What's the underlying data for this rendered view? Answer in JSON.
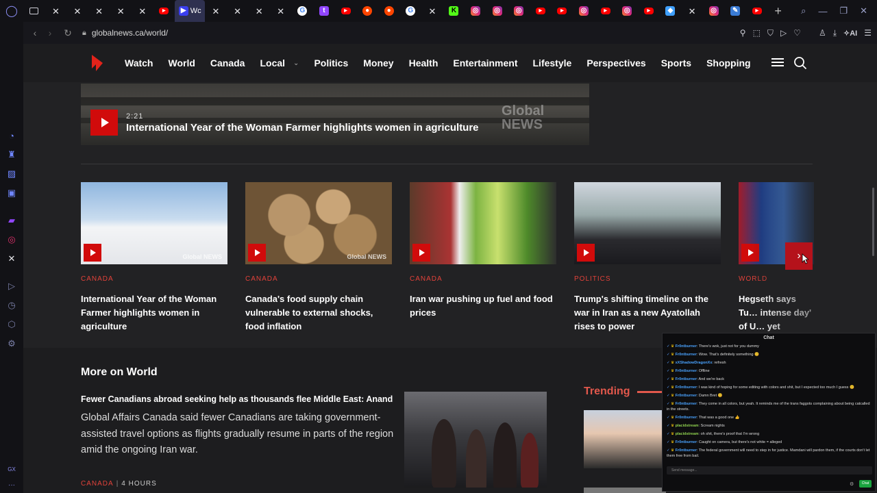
{
  "browser": {
    "url": "globalnews.ca/world/",
    "active_tab_label": "Wc",
    "tabs": [
      "mail",
      "x",
      "x",
      "x",
      "x",
      "x",
      "yt",
      "wc",
      "x",
      "x",
      "x",
      "x",
      "g",
      "tw",
      "yt",
      "rd",
      "rd",
      "g",
      "x",
      "kk",
      "ig",
      "ig",
      "ig",
      "yt",
      "yt",
      "ig",
      "yt",
      "ig",
      "yt",
      "bl",
      "x",
      "ig",
      "pen",
      "yt"
    ],
    "ai_label": "AI",
    "sidebar_label": "GX"
  },
  "site_nav": {
    "items": [
      "Watch",
      "World",
      "Canada",
      "Local",
      "Politics",
      "Money",
      "Health",
      "Entertainment",
      "Lifestyle",
      "Perspectives",
      "Sports",
      "Shopping"
    ]
  },
  "hero": {
    "duration": "2:21",
    "title": "International Year of the Woman Farmer highlights women in agriculture",
    "watermark_line1": "Global",
    "watermark_line2": "NEWS"
  },
  "cards": [
    {
      "category": "CANADA",
      "title": "International Year of the Woman Farmer highlights women in agriculture",
      "watermark": "Global NEWS"
    },
    {
      "category": "CANADA",
      "title": "Canada's food supply chain vulnerable to external shocks, food inflation",
      "watermark": "Global NEWS"
    },
    {
      "category": "CANADA",
      "title": "Iran war pushing up fuel and food prices",
      "watermark": ""
    },
    {
      "category": "POLITICS",
      "title": "Trump's shifting timeline on the war in Iran as a new Ayatollah rises to power",
      "watermark": ""
    },
    {
      "category": "WORLD",
      "title": "Hegseth says Tu… intense day' of U… yet",
      "watermark": ""
    }
  ],
  "more_on_world": {
    "heading": "More on World",
    "article_title": "Fewer Canadians abroad seeking help as thousands flee Middle East: Anand",
    "article_summary": "Global Affairs Canada said fewer Canadians are taking government-assisted travel options as flights gradually resume in parts of the region amid the ongoing Iran war.",
    "article_category": "CANADA",
    "article_time": "4 HOURS",
    "meta_separator": "|"
  },
  "trending": {
    "heading": "Trending"
  },
  "chat": {
    "title": "Chat",
    "messages": [
      {
        "user": "Fr0ntburner",
        "text": "There's wok, just not for you dummy"
      },
      {
        "user": "Fr0ntburner",
        "text": "Wow. That's definitely something 😊"
      },
      {
        "user": "xXShadowDragonXx",
        "text": "refresh"
      },
      {
        "user": "Fr0ntburner",
        "text": "Offline"
      },
      {
        "user": "Fr0ntburner",
        "text": "And we're back"
      },
      {
        "user": "Fr0ntburner",
        "text": "I was kind of hoping for some editing with colors and shit, but I expected too much I guess 😊"
      },
      {
        "user": "Fr0ntburner",
        "text": "Damn Bret 😊"
      },
      {
        "user": "Fr0ntburner",
        "text": "They come in all colors, but yeah. It reminds me of the trans faggots complaining about being catcalled in the streets."
      },
      {
        "user": "Fr0ntburner",
        "text": "That was a good one 👍"
      },
      {
        "user": "placidstream",
        "text": "Scream nights"
      },
      {
        "user": "placidstream",
        "text": "oh shit, there's proof that I'm wrong"
      },
      {
        "user": "Fr0ntburner",
        "text": "Caught on camera, but there's not white = alleged"
      },
      {
        "user": "Fr0ntburner",
        "text": "The federal government will need to step in for justice. Mamdani will pardon them, if the courts don't let them free from bail."
      }
    ],
    "input_placeholder": "Send message...",
    "send_label": "Chat"
  }
}
